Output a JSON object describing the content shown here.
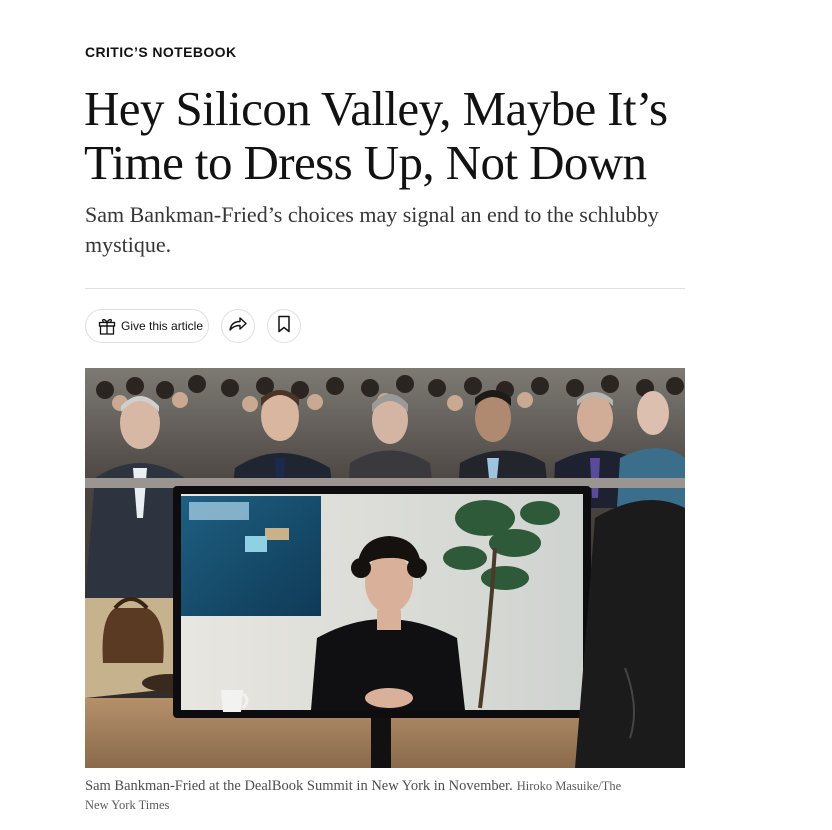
{
  "article": {
    "kicker": "CRITIC’S NOTEBOOK",
    "headline": "Hey Silicon Valley, Maybe It’s Time to Dress Up, Not Down",
    "summary": "Sam Bankman-Fried’s choices may signal an end to the schlubby mystique."
  },
  "toolbar": {
    "gift_label": "Give this article",
    "gift_icon": "gift-icon",
    "share_icon": "share-icon",
    "save_icon": "bookmark-icon"
  },
  "media": {
    "caption": "Sam Bankman-Fried at the DealBook Summit in New York in November.",
    "credit": "Hiroko Masuike/The New York Times"
  },
  "colors": {
    "text": "#121212",
    "summary_text": "#363636",
    "caption_text": "#4e4e4e",
    "divider": "#dfdfdf",
    "button_border": "#dfdfdf"
  }
}
